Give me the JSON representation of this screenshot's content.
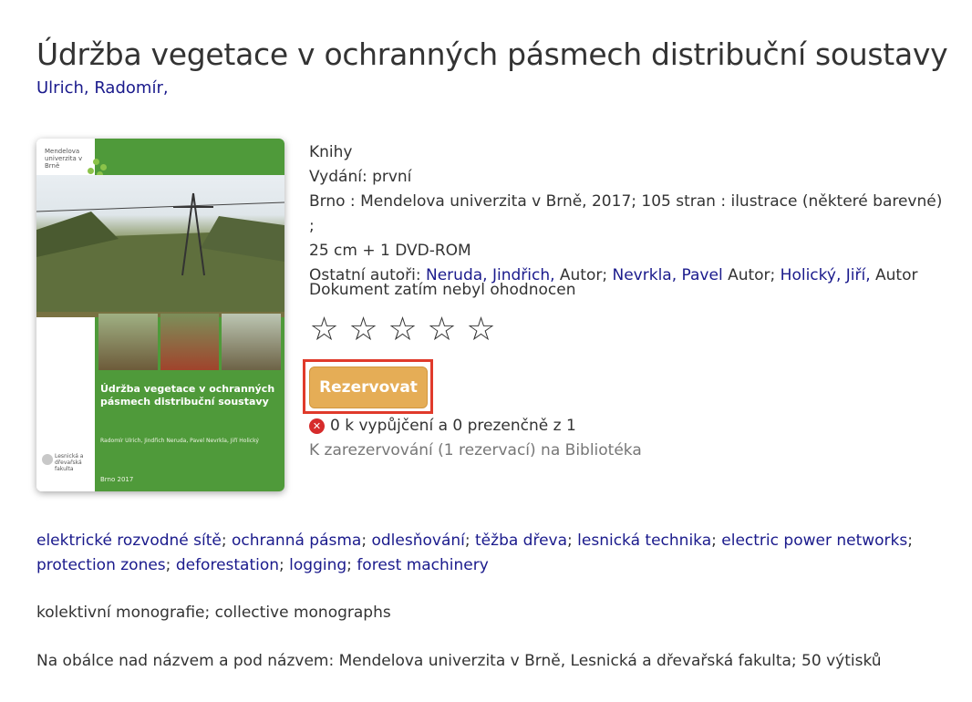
{
  "title": "Údržba vegetace v ochranných pásmech distribuční soustavy",
  "author": "Ulrich, Radomír,",
  "cover": {
    "publisher_logo_text": "Mendelova univerzita v Brně",
    "title": "Údržba vegetace v ochranných pásmech distribuční soustavy",
    "authors": "Radomír Ulrich, Jindřich Neruda, Pavel Nevrkla, Jiří Holický",
    "faculty": "Lesnická a dřevařská fakulta",
    "year": "Brno 2017"
  },
  "details": {
    "type": "Knihy",
    "edition": "Vydání: první",
    "publication": "Brno : Mendelova univerzita v Brně, 2017; 105 stran : ilustrace (některé barevné) ;",
    "extent": "25 cm + 1 DVD-ROM",
    "other_authors_label": "Ostatní autoři:",
    "other_authors": [
      {
        "name": "Neruda, Jindřich,",
        "role": "Autor;"
      },
      {
        "name": "Nevrkla, Pavel",
        "role": "Autor;"
      },
      {
        "name": "Holický, Jiří,",
        "role": "Autor"
      }
    ]
  },
  "rating": {
    "label": "Dokument zatím nebyl ohodnocen",
    "stars": [
      "☆",
      "☆",
      "☆",
      "☆",
      "☆"
    ],
    "value": 0,
    "max": 5
  },
  "reserve_button": "Rezervovat",
  "availability": "0 k vypůjčení a 0 prezenčně z 1",
  "reserve_info": "K zarezervování (1 rezervací) na Bibliotéka",
  "subjects": [
    "elektrické rozvodné sítě",
    "ochranná pásma",
    "odlesňování",
    "těžba dřeva",
    "lesnická technika",
    "electric power networks",
    "protection zones",
    "deforestation",
    "logging",
    "forest machinery"
  ],
  "subject_separator": ";",
  "genre": "kolektivní monografie; collective monographs",
  "note": "Na obálce nad názvem a pod názvem: Mendelova univerzita v Brně, Lesnická a dřevařská fakulta; 50 výtisků",
  "colors": {
    "link": "#1a1a8c",
    "button": "#e5ad56",
    "highlight_border": "#e03a2b",
    "cover_green": "#4f9a3a"
  }
}
